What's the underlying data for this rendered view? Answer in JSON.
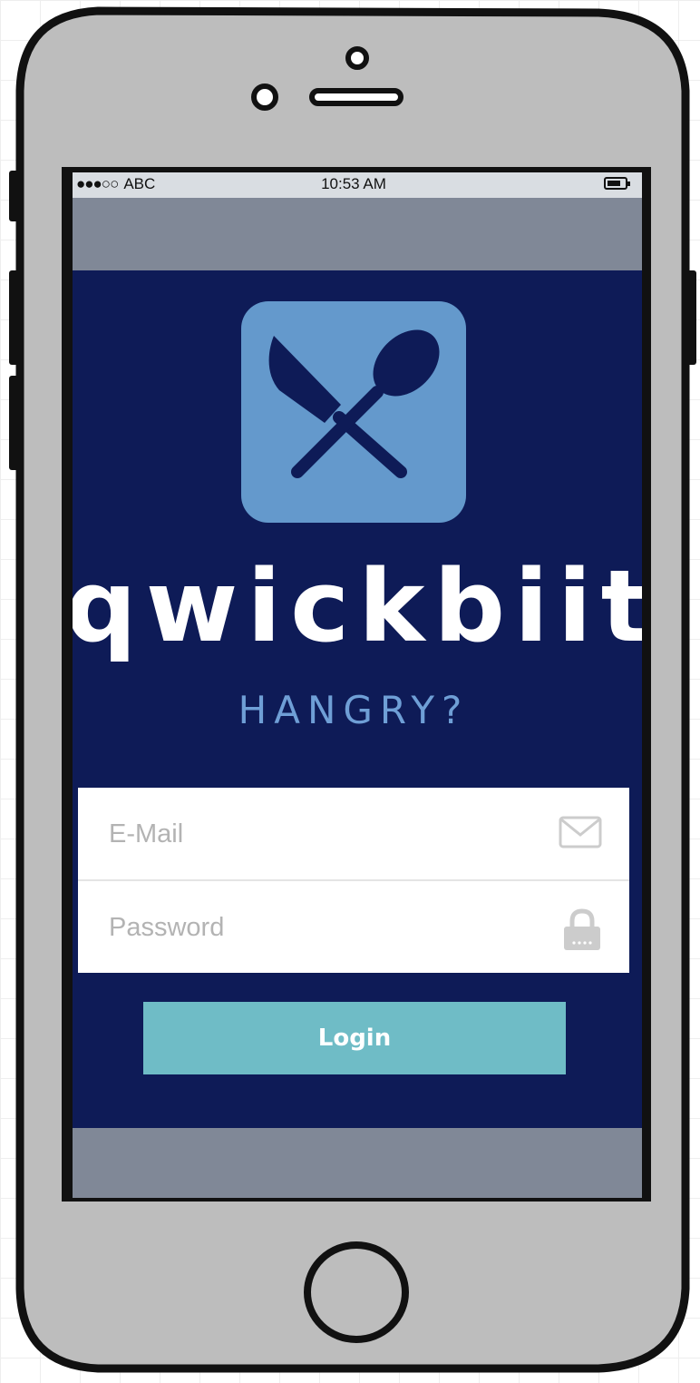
{
  "status_bar": {
    "carrier_signal": "●●●○○",
    "carrier": "ABC",
    "time": "10:53 AM",
    "battery_icon": "battery-icon"
  },
  "app": {
    "logo_icon": "utensils-crossed-icon",
    "name": "qwickbiit",
    "tagline": "HANGRY?"
  },
  "form": {
    "email": {
      "placeholder": "E-Mail",
      "value": "",
      "icon": "envelope-icon"
    },
    "password": {
      "placeholder": "Password",
      "value": "",
      "icon": "lock-icon"
    },
    "login_label": "Login"
  },
  "colors": {
    "app_background": "#0e1b57",
    "logo_tile": "#6499cc",
    "tagline": "#6f9fd6",
    "login_button": "#6fbcc6",
    "phone_body": "#bdbdbd",
    "status_bar": "#d9dde2"
  }
}
